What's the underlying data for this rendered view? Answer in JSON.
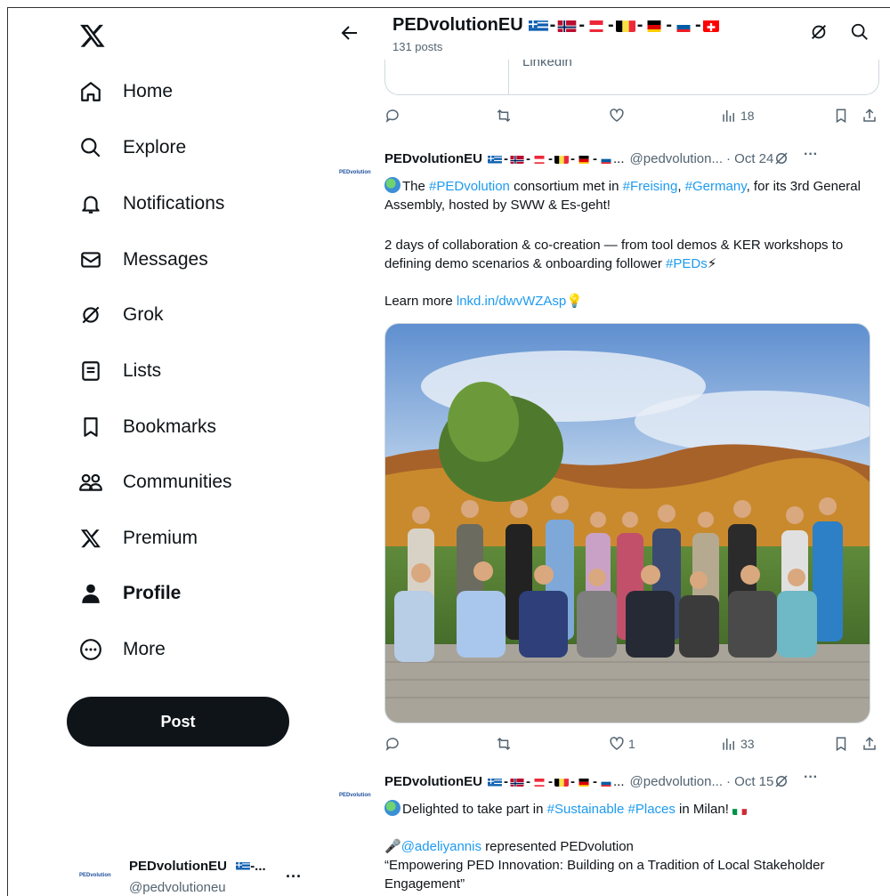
{
  "sidebar": {
    "logo_label": "X",
    "items": [
      {
        "label": "Home",
        "icon": "home-icon"
      },
      {
        "label": "Explore",
        "icon": "search-icon"
      },
      {
        "label": "Notifications",
        "icon": "bell-icon"
      },
      {
        "label": "Messages",
        "icon": "envelope-icon"
      },
      {
        "label": "Grok",
        "icon": "grok-icon"
      },
      {
        "label": "Lists",
        "icon": "list-icon"
      },
      {
        "label": "Bookmarks",
        "icon": "bookmark-icon"
      },
      {
        "label": "Communities",
        "icon": "people-icon"
      },
      {
        "label": "Premium",
        "icon": "x-icon"
      },
      {
        "label": "Profile",
        "icon": "person-icon",
        "active": true
      },
      {
        "label": "More",
        "icon": "more-circle-icon"
      }
    ],
    "post_label": "Post",
    "account": {
      "avatar_text": "PEDvolution",
      "name": "PEDvolutionEU",
      "handle": "@pedvolutioneu",
      "menu": "···"
    }
  },
  "header": {
    "title": "PEDvolutionEU",
    "posts_count": "131 posts"
  },
  "card_stub": {
    "text": "Linkedin"
  },
  "tweet_prev_actions": {
    "views": "18"
  },
  "tweet1": {
    "avatar_text": "PEDvolution",
    "name": "PEDvolutionEU",
    "ellipsis": "...",
    "handle": "@pedvolution...",
    "date": "· Oct 24",
    "more": "···",
    "line1_a": "The ",
    "tag_pedvolution": "#PEDvolution",
    "line1_b": " consortium met in ",
    "tag_freising": "#Freising",
    "comma": ", ",
    "tag_germany": "#Germany",
    "line1_c": ", for its 3rd General Assembly, hosted by SWW & Es-geht!",
    "line2": "2 days of collaboration & co-creation — from tool demos & KER workshops to defining demo scenarios & onboarding follower ",
    "tag_peds": "#PEDs",
    "bolt": "⚡",
    "line3": "Learn more ",
    "link": "lnkd.in/dwvWZAsp",
    "bulb": "💡",
    "likes": "1",
    "views": "33"
  },
  "tweet2": {
    "avatar_text": "PEDvolution",
    "name": "PEDvolutionEU",
    "ellipsis": "...",
    "handle": "@pedvolution...",
    "date": "· Oct 15",
    "more": "···",
    "line1_a": "Delighted to take part in ",
    "tag_sustainable": "#Sustainable",
    "space": " ",
    "tag_places": "#Places",
    "line1_b": " in Milan! ",
    "mic": "🎤",
    "mention": "@adeliyannis",
    "line2": "  represented PEDvolution",
    "quote": "“Empowering PED Innovation: Building on a Tradition of Local Stakeholder Engagement”"
  },
  "colors": {
    "accent": "#1d9bf0",
    "text": "#0f1419",
    "muted": "#536471"
  }
}
